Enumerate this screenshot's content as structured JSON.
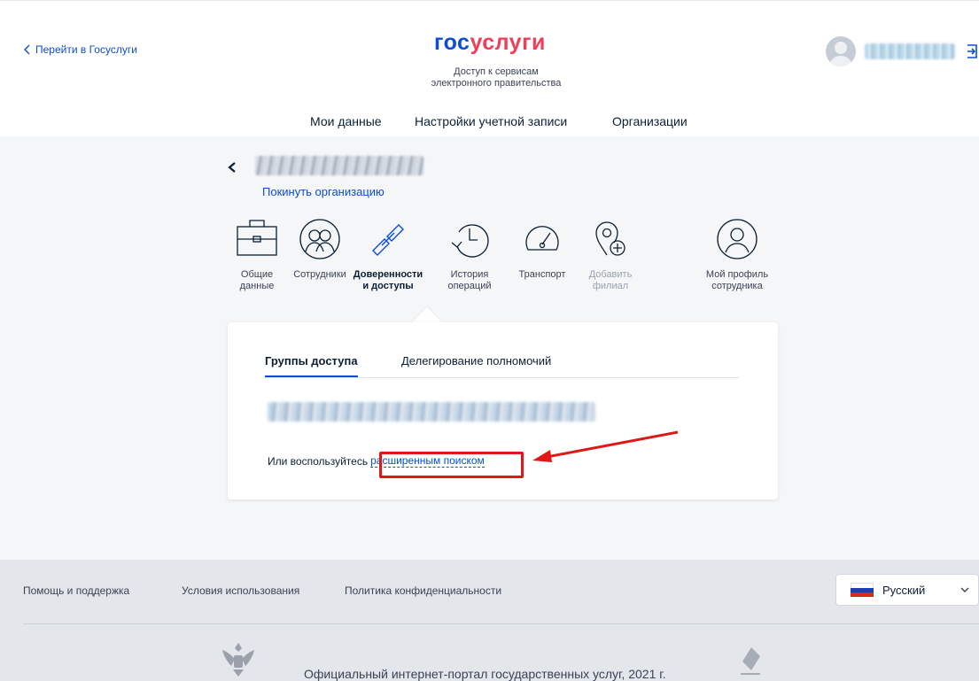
{
  "header": {
    "back_label": "Перейти в Госуслуги",
    "logo_part1": "гос",
    "logo_part2": "услуги",
    "tagline_line1": "Доступ к сервисам",
    "tagline_line2": "электронного правительства"
  },
  "nav": {
    "items": [
      {
        "label": "Мои данные"
      },
      {
        "label": "Настройки учетной записи"
      },
      {
        "label": "Организации",
        "active": true
      }
    ]
  },
  "org": {
    "leave_label": "Покинуть организацию"
  },
  "sections": [
    {
      "line1": "Общие",
      "line2": "данные",
      "icon": "briefcase-icon"
    },
    {
      "line1": "Сотрудники",
      "line2": "",
      "icon": "employees-icon"
    },
    {
      "line1": "Доверенности",
      "line2": "и доступы",
      "icon": "link-icon",
      "active": true
    },
    {
      "line1": "История",
      "line2": "операций",
      "icon": "history-icon"
    },
    {
      "line1": "Транспорт",
      "line2": "",
      "icon": "speedometer-icon"
    },
    {
      "line1": "Добавить",
      "line2": "филиал",
      "icon": "add-location-icon",
      "disabled": true
    },
    {
      "line1": "Мой профиль",
      "line2": "сотрудника",
      "icon": "profile-icon"
    }
  ],
  "tabs": [
    {
      "label": "Группы доступа",
      "active": true
    },
    {
      "label": "Делегирование полномочий"
    }
  ],
  "search": {
    "prefix": "Или воспользуйтесь",
    "link": "расширенным поиском"
  },
  "footer": {
    "links": [
      "Помощь и поддержка",
      "Условия использования",
      "Политика конфиденциальности"
    ],
    "language": "Русский",
    "copyright": "Официальный интернет-портал государственных услуг, 2021 г."
  },
  "colors": {
    "brand_blue": "#0d4cd3",
    "brand_red": "#ee3f58",
    "highlight_red": "#e01717"
  }
}
